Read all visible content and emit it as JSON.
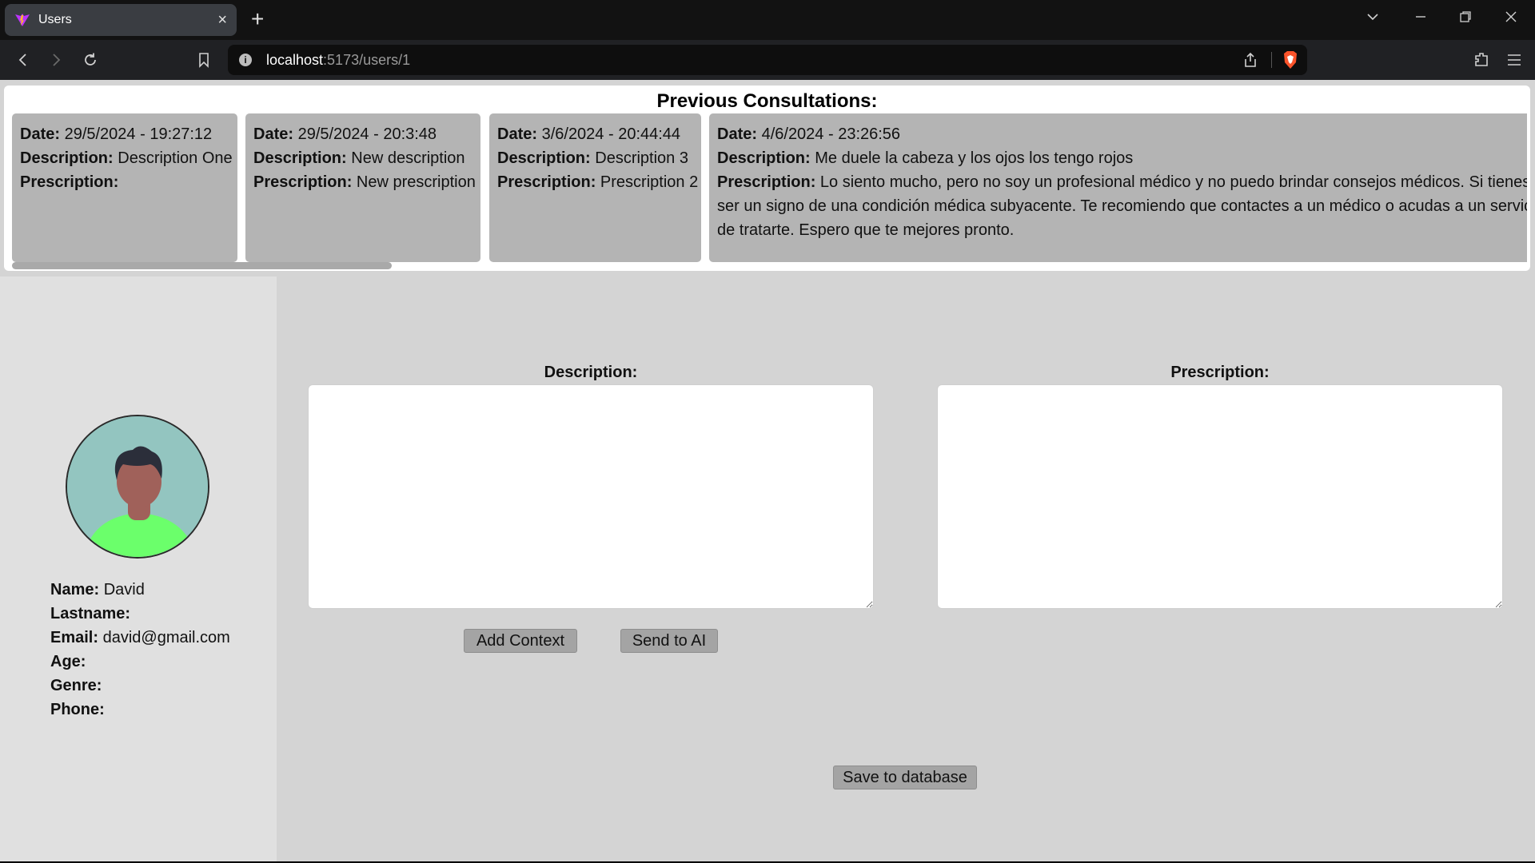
{
  "browser": {
    "tab_title": "Users",
    "url_host": "localhost",
    "url_rest": ":5173/users/1"
  },
  "consultations": {
    "title": "Previous Consultations:",
    "labels": {
      "date": "Date:",
      "description": "Description:",
      "prescription": "Prescription:"
    },
    "items": [
      {
        "date": "29/5/2024 - 19:27:12",
        "description": "Description One",
        "prescription": ""
      },
      {
        "date": "29/5/2024 - 20:3:48",
        "description": "New description",
        "prescription": "New prescription"
      },
      {
        "date": "3/6/2024 - 20:44:44",
        "description": "Description 3",
        "prescription": "Prescription 2"
      },
      {
        "date": "4/6/2024 - 23:26:56",
        "description": "Me duele la cabeza y los ojos los tengo rojos",
        "prescription": "Lo siento mucho, pero no soy un profesional médico y no puedo brindar consejos médicos. Si tienes ser un signo de una condición médica subyacente. Te recomiendo que contactes a un médico o acudas a un servici de tratarte. Espero que te mejores pronto."
      }
    ]
  },
  "user": {
    "labels": {
      "name": "Name:",
      "lastname": "Lastname:",
      "email": "Email:",
      "age": "Age:",
      "genre": "Genre:",
      "phone": "Phone:"
    },
    "name": "David",
    "lastname": "",
    "email": "david@gmail.com",
    "age": "",
    "genre": "",
    "phone": ""
  },
  "form": {
    "description_label": "Description:",
    "prescription_label": "Prescription:",
    "description_value": "",
    "prescription_value": "",
    "add_context_label": "Add Context",
    "send_ai_label": "Send to AI",
    "save_label": "Save to database"
  },
  "colors": {
    "avatar_bg": "#93c5c0",
    "avatar_shirt": "#6bff6b",
    "avatar_skin": "#a0615a",
    "avatar_hair": "#2b2e3a",
    "brave_orange": "#fb542b"
  }
}
